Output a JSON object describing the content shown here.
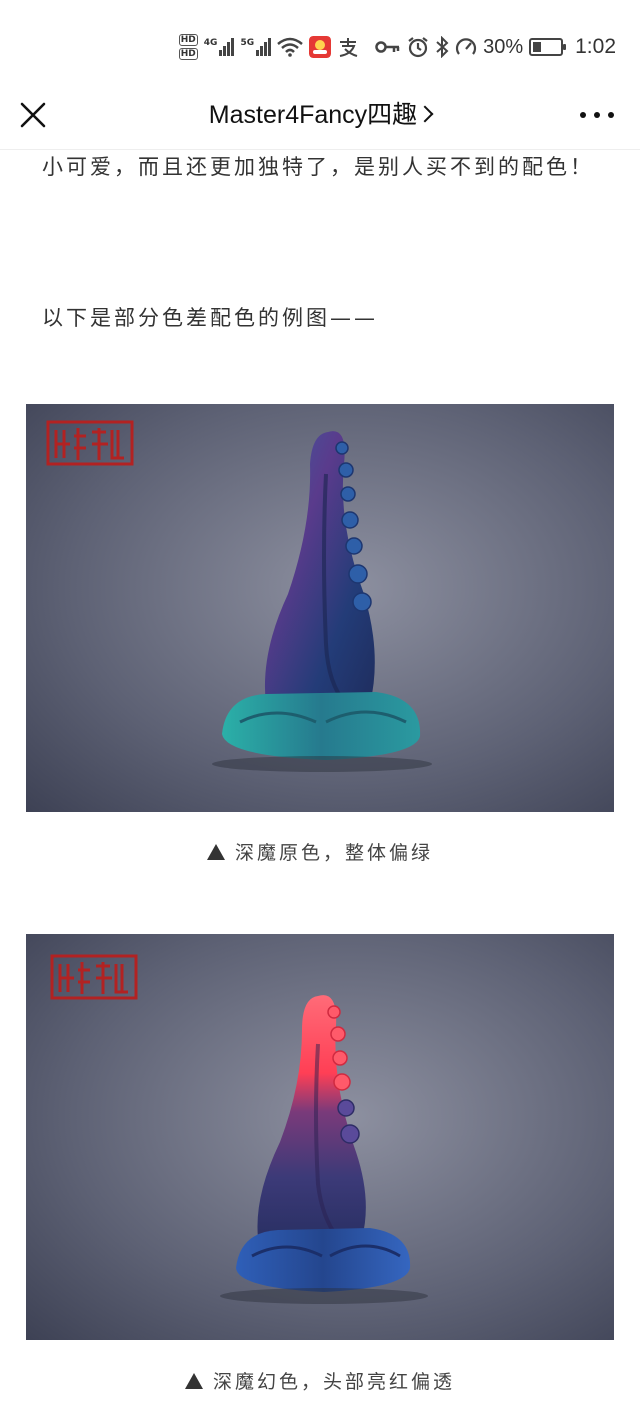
{
  "status_bar": {
    "hd1": "HD",
    "hd2": "HD",
    "net1": "4G",
    "net2": "5G",
    "battery_percent_text": "30%",
    "battery_level": 0.3,
    "time": "1:02"
  },
  "nav": {
    "title": "Master4Fancy四趣"
  },
  "article": {
    "paragraph1": "小可爱，而且还更加独特了，是别人买不到的配色！",
    "paragraph2": "以下是部分色差配色的例图——",
    "image1_logo": "四趣",
    "image2_logo": "四趣",
    "caption1": "深魔原色，整体偏绿",
    "caption2": "深魔幻色，头部亮红偏透"
  },
  "colors": {
    "background": "#ffffff",
    "text": "#333333",
    "photo_bg": "#6a6e80",
    "logo_red": "#b22222",
    "product1_teal": "#2aa8a8",
    "product2_red": "#ff4a5a"
  },
  "icons": [
    "wifi-icon",
    "key-icon",
    "alarm-icon",
    "bluetooth-icon",
    "speedometer-icon",
    "battery-icon",
    "close-icon",
    "more-icon",
    "triangle-icon"
  ]
}
